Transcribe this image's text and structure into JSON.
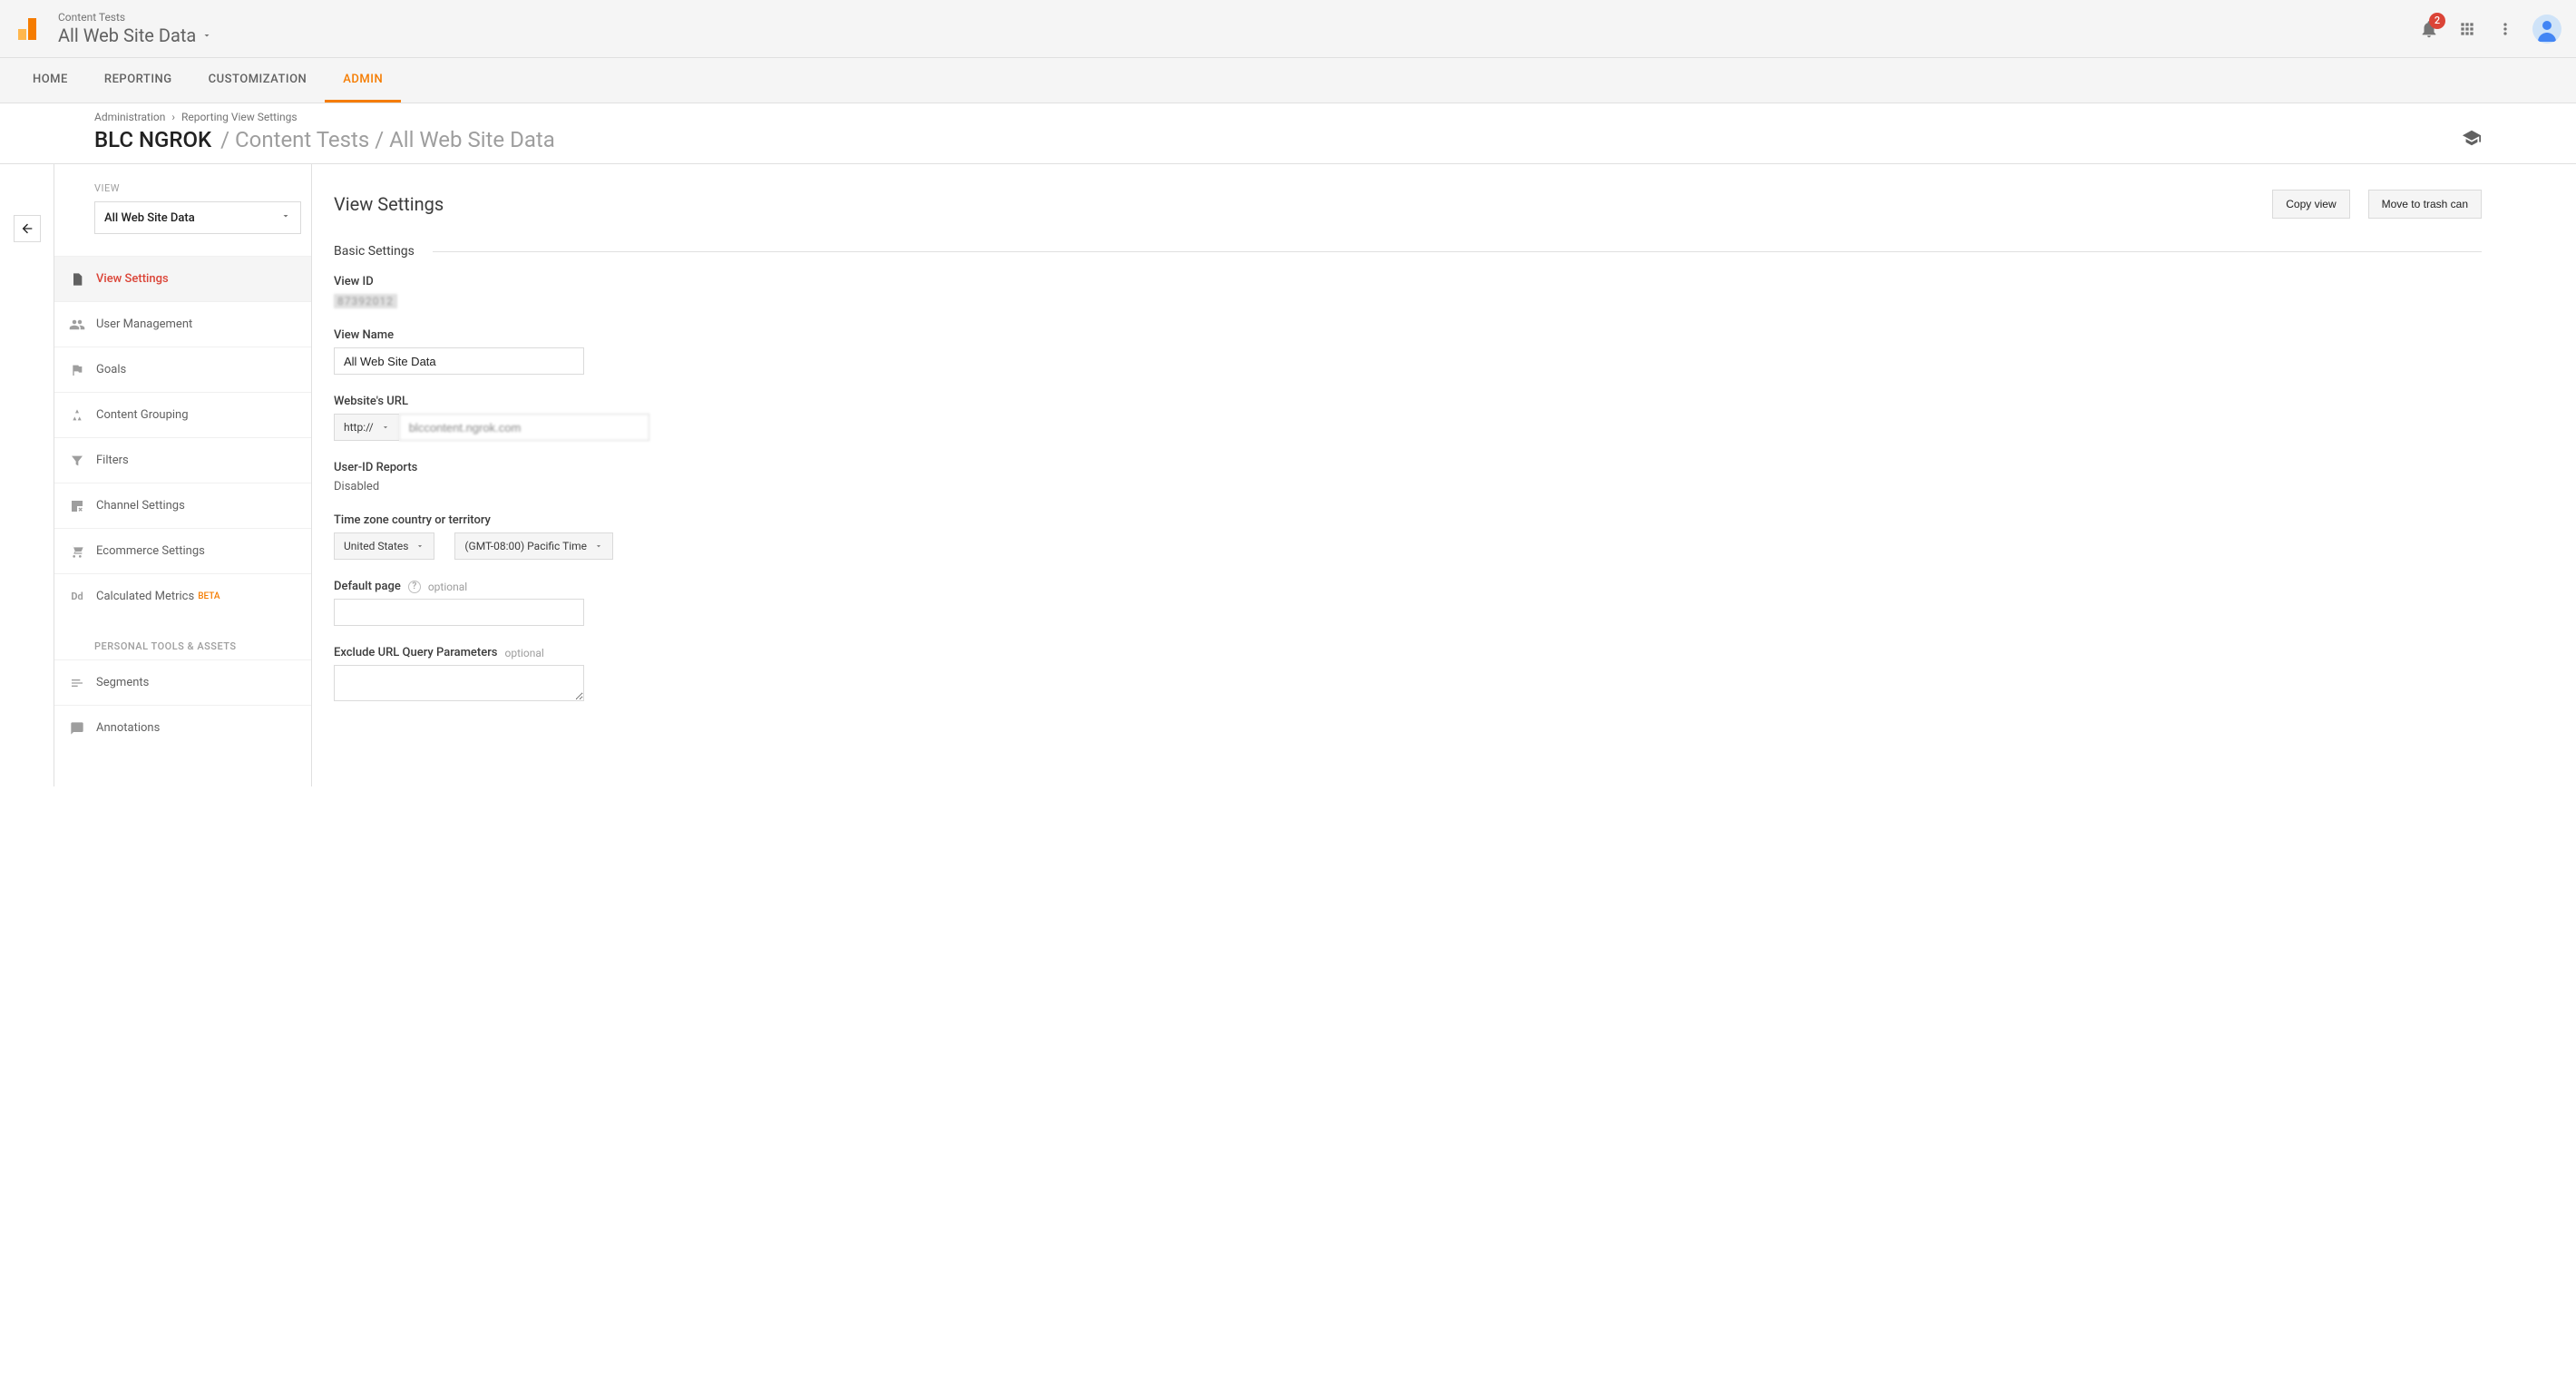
{
  "header": {
    "context_label": "Content Tests",
    "property_label": "All Web Site Data",
    "notification_count": "2"
  },
  "nav": {
    "tabs": [
      "HOME",
      "REPORTING",
      "CUSTOMIZATION",
      "ADMIN"
    ],
    "active_index": 3
  },
  "breadcrumb": {
    "items": [
      "Administration",
      "Reporting View Settings"
    ]
  },
  "page": {
    "account": "BLC NGROK",
    "path_label": "/ Content Tests / All Web Site Data"
  },
  "sidebar": {
    "section_label": "VIEW",
    "view_selector_value": "All Web Site Data",
    "items": [
      {
        "label": "View Settings",
        "icon": "file-icon"
      },
      {
        "label": "User Management",
        "icon": "people-icon"
      },
      {
        "label": "Goals",
        "icon": "flag-icon"
      },
      {
        "label": "Content Grouping",
        "icon": "group-icon"
      },
      {
        "label": "Filters",
        "icon": "funnel-icon"
      },
      {
        "label": "Channel Settings",
        "icon": "channel-icon"
      },
      {
        "label": "Ecommerce Settings",
        "icon": "cart-icon"
      },
      {
        "label": "Calculated Metrics",
        "icon": "dd-icon",
        "beta": "BETA"
      }
    ],
    "personal_heading": "PERSONAL TOOLS & ASSETS",
    "personal_items": [
      {
        "label": "Segments",
        "icon": "segments-icon"
      },
      {
        "label": "Annotations",
        "icon": "annotations-icon"
      }
    ]
  },
  "main": {
    "title": "View Settings",
    "actions": {
      "copy": "Copy view",
      "trash": "Move to trash can"
    },
    "section_basic": "Basic Settings",
    "fields": {
      "view_id_label": "View ID",
      "view_id_value": "87392012",
      "view_name_label": "View Name",
      "view_name_value": "All Web Site Data",
      "website_url_label": "Website's URL",
      "website_url_protocol": "http://",
      "website_url_value": "blccontent.ngrok.com",
      "userid_label": "User-ID Reports",
      "userid_value": "Disabled",
      "tz_label": "Time zone country or territory",
      "tz_country": "United States",
      "tz_zone": "(GMT-08:00) Pacific Time",
      "default_page_label": "Default page",
      "optional_text": "optional",
      "default_page_value": "",
      "exclude_params_label": "Exclude URL Query Parameters",
      "exclude_params_value": ""
    }
  }
}
